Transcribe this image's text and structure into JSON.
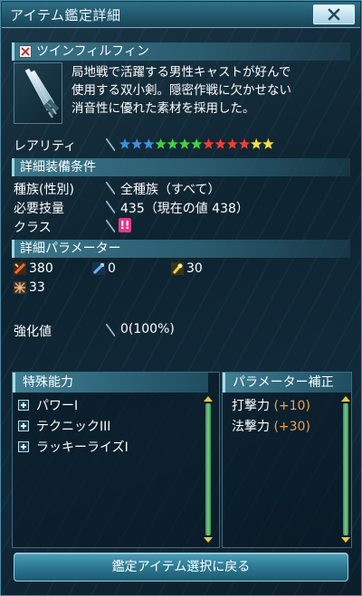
{
  "window": {
    "title": "アイテム鑑定詳細",
    "close_icon": "close-x-icon"
  },
  "item": {
    "type_icon": "twin-sabers-icon",
    "name": "ツインフィルフィン",
    "description_lines": [
      "局地戦で活躍する男性キャストが好んで",
      "使用する双小剣。隠密作戦に欠かせない",
      "消音性に優れた素材を採用した。"
    ]
  },
  "rarity": {
    "label": "レアリティ",
    "stars": 13,
    "star_colors": [
      "#3f8fe0",
      "#3f8fe0",
      "#3f8fe0",
      "#43d046",
      "#43d046",
      "#43d046",
      "#43d046",
      "#e8413a",
      "#e8413a",
      "#e8413a",
      "#e8413a",
      "#f2e04a",
      "#f2e04a"
    ]
  },
  "requirements": {
    "header": "詳細装備条件",
    "race_label": "種族(性別)",
    "race_value": "全種族（すべて）",
    "skill_label": "必要技量",
    "skill_value": "435（現在の値 438）",
    "class_label": "クラス",
    "class_value": "!!"
  },
  "parameters": {
    "header": "詳細パラメーター",
    "stats": [
      {
        "icon": "striking-attack-icon",
        "value": "380"
      },
      {
        "icon": "ranged-attack-icon",
        "value": "0"
      },
      {
        "icon": "technique-attack-icon",
        "value": "30"
      },
      {
        "icon": "dexterity-icon",
        "value": "33"
      }
    ]
  },
  "enhancement": {
    "label": "強化値",
    "value": "0(100%)"
  },
  "abilities": {
    "header": "特殊能力",
    "items": [
      {
        "label": "パワーI"
      },
      {
        "label": "テクニックIII"
      },
      {
        "label": "ラッキーライズI"
      }
    ]
  },
  "param_correction": {
    "header": "パラメーター補正",
    "items": [
      {
        "label": "打撃力",
        "value": "(+10)"
      },
      {
        "label": "法撃力",
        "value": "(+30)"
      }
    ]
  },
  "footer": {
    "button_label": "鑑定アイテム選択に戻る"
  }
}
